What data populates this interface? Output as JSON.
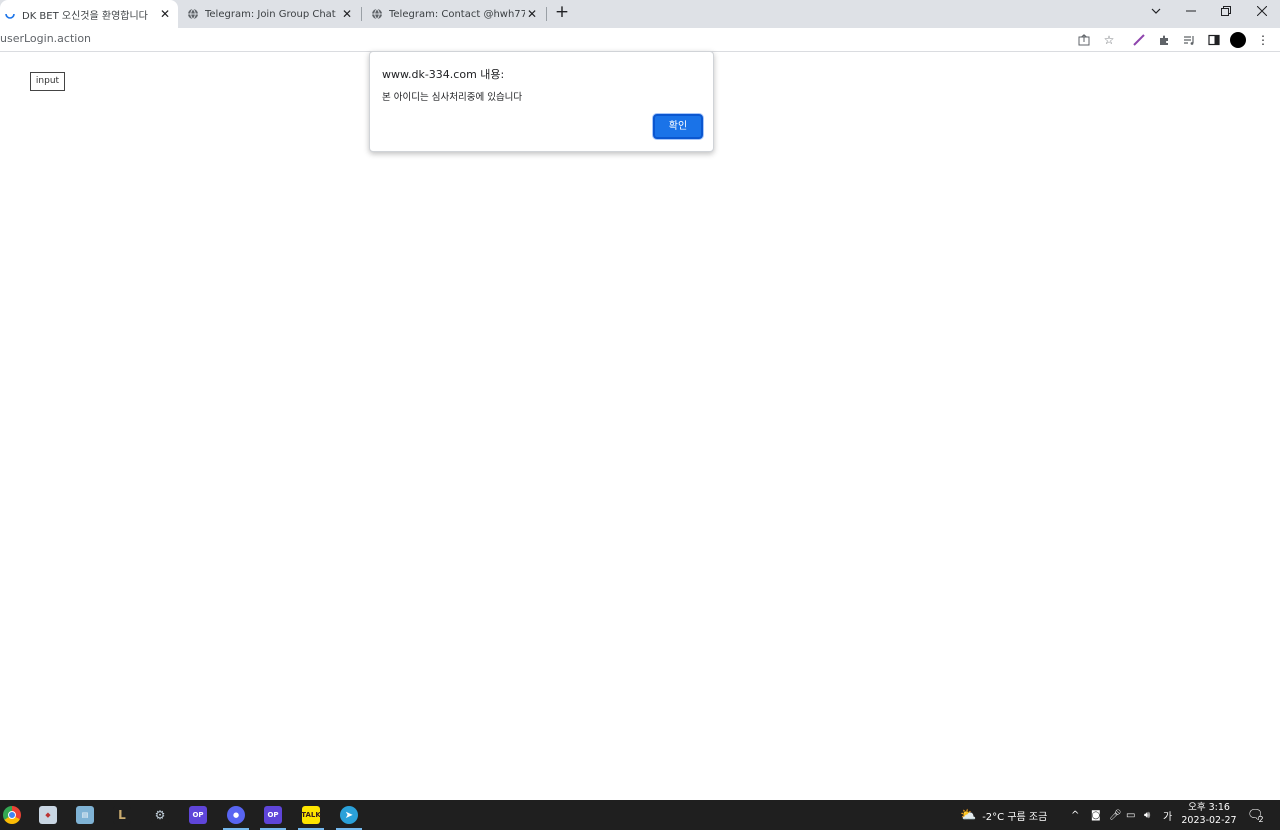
{
  "browser": {
    "tabs": [
      {
        "title": "DK BET 오신것을 환영합니다",
        "active": true,
        "favicon": "loading-spinner-icon"
      },
      {
        "title": "Telegram: Join Group Chat",
        "active": false,
        "favicon": "globe-icon"
      },
      {
        "title": "Telegram: Contact @hwh77",
        "active": false,
        "favicon": "globe-icon"
      }
    ],
    "url": "userLogin.action"
  },
  "page": {
    "input_label": "input"
  },
  "dialog": {
    "origin": "www.dk-334.com 내용:",
    "message": "본 아이디는 심사처리중에 있습니다",
    "ok_label": "확인"
  },
  "taskbar": {
    "apps": [
      "chrome",
      "app-2",
      "app-3",
      "league-of-legends",
      "steam",
      "opgg",
      "discord-like",
      "opgg-2",
      "kakaotalk",
      "telegram"
    ],
    "weather": "-2°C  구름 조금",
    "ime": "가",
    "time": "오후 3:16",
    "date": "2023-02-27",
    "notifications": "2"
  },
  "colors": {
    "accent": "#1a73e8",
    "tabstrip": "#dee1e6",
    "taskbar": "#1f1f1f"
  }
}
